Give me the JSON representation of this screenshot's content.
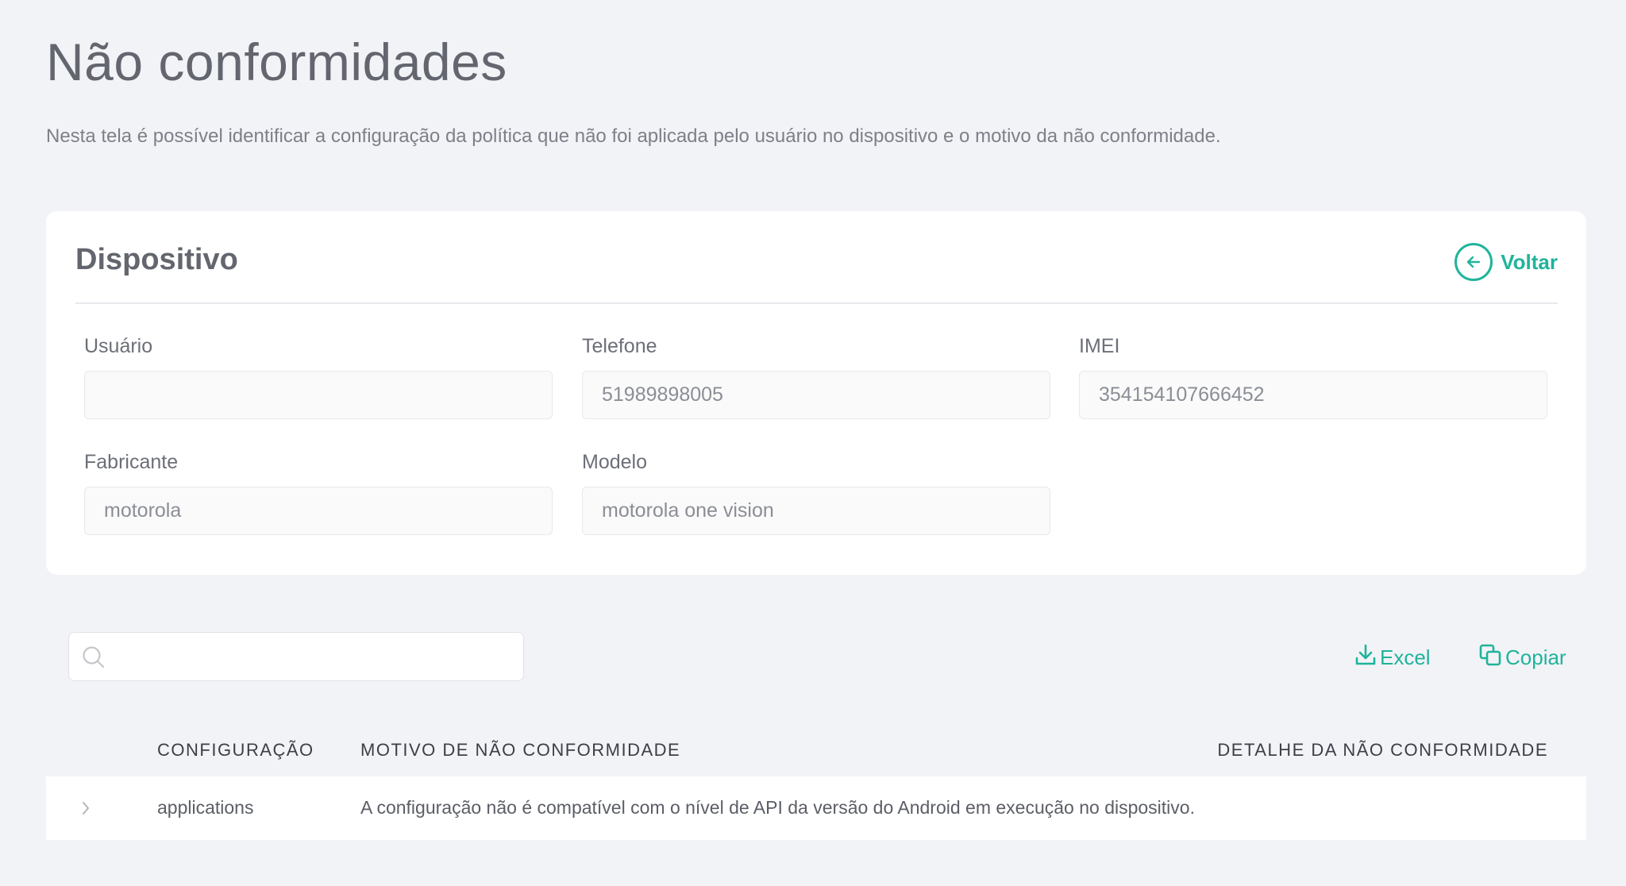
{
  "header": {
    "title": "Não conformidades",
    "description": "Nesta tela é possível identificar a configuração da política que não foi aplicada pelo usuário no dispositivo e o motivo da não conformidade."
  },
  "device": {
    "title": "Dispositivo",
    "back_label": "Voltar",
    "fields": {
      "usuario": {
        "label": "Usuário",
        "value": ""
      },
      "telefone": {
        "label": "Telefone",
        "value": "51989898005"
      },
      "imei": {
        "label": "IMEI",
        "value": "354154107666452"
      },
      "fabricante": {
        "label": "Fabricante",
        "value": "motorola"
      },
      "modelo": {
        "label": "Modelo",
        "value": "motorola one vision"
      }
    }
  },
  "toolbar": {
    "search_value": "",
    "excel_label": "Excel",
    "copy_label": "Copiar"
  },
  "table": {
    "columns": [
      "CONFIGURAÇÃO",
      "MOTIVO DE NÃO CONFORMIDADE",
      "DETALHE DA NÃO CONFORMIDADE"
    ],
    "rows": [
      {
        "configuracao": "applications",
        "motivo": "A configuração não é compatível com o nível de API da versão do Android em execução no dispositivo.",
        "detalhe": ""
      }
    ]
  },
  "colors": {
    "accent": "#1fb49b",
    "background": "#f2f3f7",
    "card": "#ffffff"
  },
  "icons": [
    "arrow-left-icon",
    "search-icon",
    "download-icon",
    "copy-icon",
    "chevron-right-icon"
  ]
}
